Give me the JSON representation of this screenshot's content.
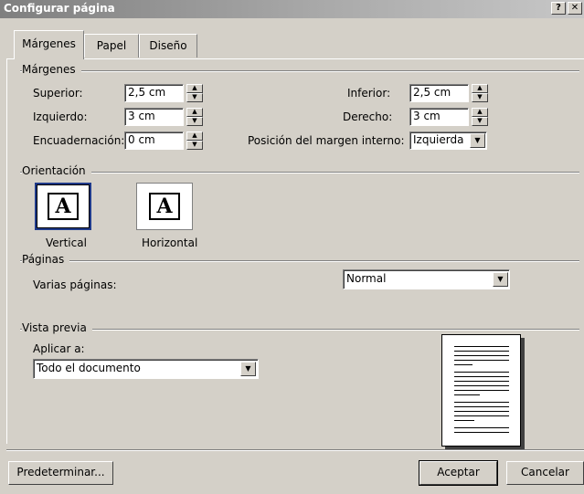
{
  "window": {
    "title": "Configurar página",
    "help_label": "?",
    "close_label": "✕"
  },
  "tabs": [
    {
      "label": "Márgenes",
      "active": true
    },
    {
      "label": "Papel",
      "active": false
    },
    {
      "label": "Diseño",
      "active": false
    }
  ],
  "margins": {
    "group_label": "Márgenes",
    "top_label": "Superior:",
    "top_value": "2,5 cm",
    "bottom_label": "Inferior:",
    "bottom_value": "2,5 cm",
    "left_label": "Izquierdo:",
    "left_value": "3 cm",
    "right_label": "Derecho:",
    "right_value": "3 cm",
    "gutter_label": "Encuadernación:",
    "gutter_value": "0 cm",
    "gutter_pos_label": "Posición del margen interno:",
    "gutter_pos_value": "Izquierda"
  },
  "orientation": {
    "group_label": "Orientación",
    "portrait_label": "Vertical",
    "landscape_label": "Horizontal",
    "glyph": "A",
    "selected": "Vertical"
  },
  "pages": {
    "group_label": "Páginas",
    "multiple_label": "Varias páginas:",
    "multiple_value": "Normal"
  },
  "preview": {
    "group_label": "Vista previa",
    "apply_label": "Aplicar a:",
    "apply_value": "Todo el documento"
  },
  "buttons": {
    "default": "Predeterminar...",
    "ok": "Aceptar",
    "cancel": "Cancelar"
  },
  "icons": {
    "spin_up": "▲",
    "spin_down": "▼",
    "dropdown": "▼"
  }
}
